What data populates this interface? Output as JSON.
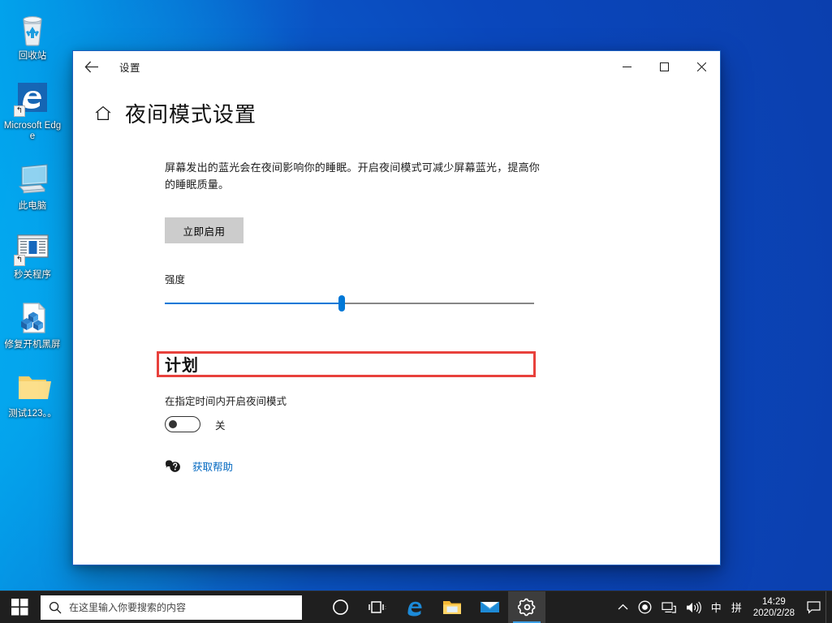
{
  "desktop": {
    "icons": [
      {
        "label": "回收站",
        "icon": "recycle-bin-icon",
        "shortcut": false
      },
      {
        "label": "Microsoft Edge",
        "icon": "edge-icon",
        "shortcut": true
      },
      {
        "label": "此电脑",
        "icon": "this-pc-icon",
        "shortcut": false
      },
      {
        "label": "秒关程序",
        "icon": "app-window-icon",
        "shortcut": true
      },
      {
        "label": "修复开机黑屏",
        "icon": "registry-file-icon",
        "shortcut": false
      },
      {
        "label": "测试123。。",
        "icon": "folder-icon",
        "shortcut": false
      }
    ],
    "wallpaper_accent": "#0aa4ec",
    "wallpaper_deep": "#0a47bc"
  },
  "window": {
    "title": "设置",
    "back_icon": "back-arrow-icon",
    "controls": {
      "minimize": "—",
      "maximize": "□",
      "close": "✕"
    },
    "page": {
      "home_icon": "home-icon",
      "title": "夜间模式设置",
      "description": "屏幕发出的蓝光会在夜间影响你的睡眠。开启夜间模式可减少屏幕蓝光，提高你的睡眠质量。",
      "enable_button": "立即启用",
      "slider": {
        "label": "强度",
        "value": 48,
        "min": 0,
        "max": 100,
        "fill_color": "#0078d7",
        "track_color": "#868686",
        "highlight_color": "#e8413c"
      },
      "schedule": {
        "heading": "计划",
        "subtitle": "在指定时间内开启夜间模式",
        "toggle_state": "关",
        "toggle_on": false
      },
      "help": {
        "icon": "help-bubble-icon",
        "label": "获取帮助",
        "color": "#0067c0"
      }
    }
  },
  "taskbar": {
    "start_icon": "windows-start-icon",
    "search": {
      "icon": "search-icon",
      "placeholder": "在这里输入你要搜索的内容"
    },
    "items": [
      {
        "name": "cortana-icon",
        "label": "Cortana",
        "active": false
      },
      {
        "name": "task-view-icon",
        "label": "任务视图",
        "active": false
      },
      {
        "name": "edge-icon",
        "label": "Microsoft Edge",
        "active": false
      },
      {
        "name": "file-explorer-icon",
        "label": "文件资源管理器",
        "active": false
      },
      {
        "name": "mail-icon",
        "label": "邮件",
        "active": false
      },
      {
        "name": "settings-gear-icon",
        "label": "设置",
        "active": true
      }
    ],
    "tray": {
      "chevron": "∧",
      "icons": [
        "safety-shield-icon",
        "network-icon",
        "volume-icon"
      ],
      "ime_mode": "中",
      "ime_layout": "拼",
      "time": "14:29",
      "date": "2020/2/28",
      "action_center_icon": "notification-icon"
    }
  }
}
